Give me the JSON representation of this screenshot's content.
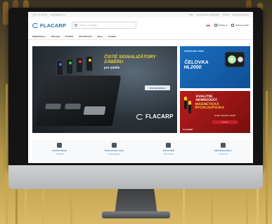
{
  "topbar": {
    "phone": "+420 737 737 007",
    "email": "flacarp@flacarp.cz",
    "links": [
      "Blog",
      "Jak nakupovat a objednávat",
      "Kontakt",
      "Obchodní podmínky"
    ]
  },
  "header": {
    "logo": "FLACARP",
    "search_placeholder": "Napište, co hledáte",
    "language": "CZ",
    "account": "Přihlášení",
    "cart": "Nákupní košík"
  },
  "nav": {
    "items": [
      "Signalizátory",
      "Návnady",
      "Krmítka",
      "Příslušenství",
      "Blog",
      "Kontakt"
    ]
  },
  "hero": {
    "main": {
      "headline": "Čisté signalizátory záběru",
      "subline": "pro rybáře",
      "button": "VÍCE INFORMACÍ",
      "brand": "FLACARP"
    },
    "side_top": {
      "tag": "Osvětlení v noci",
      "title_line1": "ČELOVKA",
      "title_line2": "HL2000"
    },
    "side_bottom": {
      "title_line1": "Kvalitní,",
      "title_line2": "nemrzoucí",
      "title_line3": "magnetická",
      "title_line4": "rychloupojka",
      "note": "Silné, odolné, lehké",
      "button": "Zobrazit",
      "brand": "FLACARP"
    }
  },
  "features": [
    {
      "title": "Doprava zdarma",
      "sub": "od 2000 Kč",
      "icon": "truck-icon"
    },
    {
      "title": "Vlastní výroba a vývoj",
      "sub": "Česká republika",
      "icon": "gear-icon"
    },
    {
      "title": "Osobní odběr",
      "sub": "Brno a Praha",
      "icon": "store-icon"
    },
    {
      "title": "Zákaznická podpora",
      "sub": "Po–Pá 8–16",
      "icon": "phone-icon"
    }
  ],
  "colors": {
    "brand_blue": "#1b6fb0",
    "banner_yellow": "#f0d33a",
    "accent_red": "#b81c1c"
  }
}
